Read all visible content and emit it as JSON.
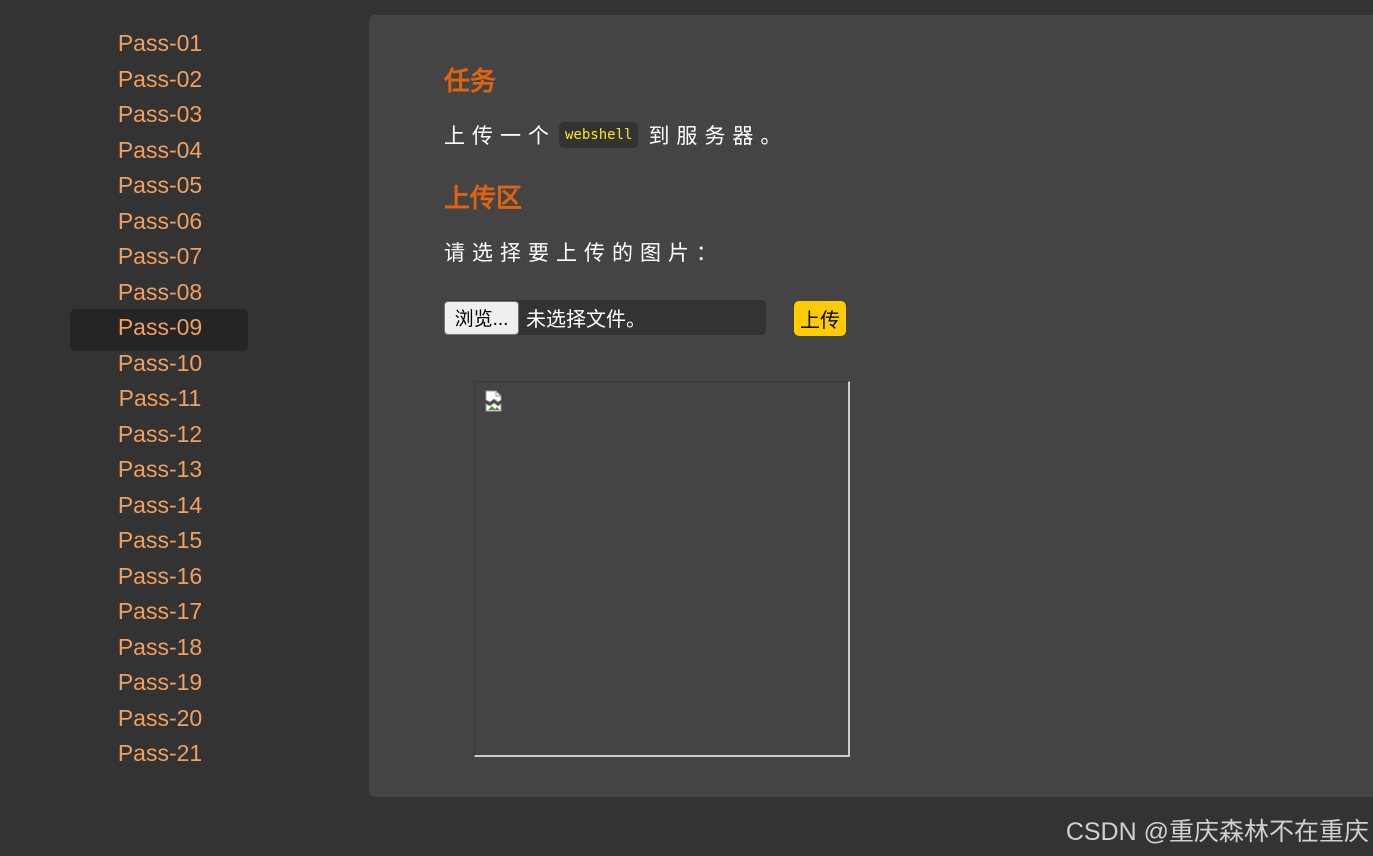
{
  "sidebar": {
    "items": [
      {
        "label": "Pass-01"
      },
      {
        "label": "Pass-02"
      },
      {
        "label": "Pass-03"
      },
      {
        "label": "Pass-04"
      },
      {
        "label": "Pass-05"
      },
      {
        "label": "Pass-06"
      },
      {
        "label": "Pass-07"
      },
      {
        "label": "Pass-08"
      },
      {
        "label": "Pass-09"
      },
      {
        "label": "Pass-10"
      },
      {
        "label": "Pass-11"
      },
      {
        "label": "Pass-12"
      },
      {
        "label": "Pass-13"
      },
      {
        "label": "Pass-14"
      },
      {
        "label": "Pass-15"
      },
      {
        "label": "Pass-16"
      },
      {
        "label": "Pass-17"
      },
      {
        "label": "Pass-18"
      },
      {
        "label": "Pass-19"
      },
      {
        "label": "Pass-20"
      },
      {
        "label": "Pass-21"
      }
    ],
    "active": "Pass-09"
  },
  "task": {
    "title": "任务",
    "desc_before": "上传一个",
    "code": "webshell",
    "desc_after": "到服务器。"
  },
  "upload": {
    "title": "上传区",
    "prompt": "请选择要上传的图片：",
    "browse_label": "浏览...",
    "file_status": "未选择文件。",
    "submit_label": "上传"
  },
  "preview": {
    "icon": "broken-image-icon"
  },
  "watermark": "CSDN @重庆森林不在重庆",
  "colors": {
    "background": "#333333",
    "panel": "#444444",
    "menu_link": "#f0a060",
    "active_item_bg": "#252525",
    "heading": "#e06410",
    "code_text": "#f8e81c",
    "submit_button": "#ffcc00"
  }
}
